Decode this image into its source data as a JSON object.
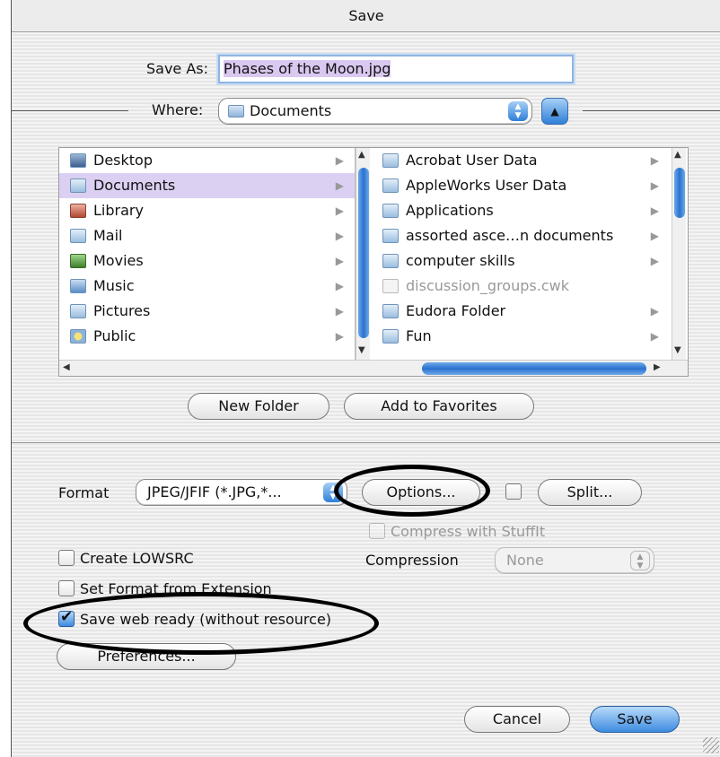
{
  "window": {
    "title": "Save"
  },
  "save_as": {
    "label": "Save As:",
    "value": "Phases of the Moon.jpg"
  },
  "where": {
    "label": "Where:",
    "value": "Documents"
  },
  "browser": {
    "column1": [
      {
        "label": "Desktop",
        "icon": "desktop-icon",
        "selected": false
      },
      {
        "label": "Documents",
        "icon": "folder-icon",
        "selected": true
      },
      {
        "label": "Library",
        "icon": "library-icon",
        "selected": false
      },
      {
        "label": "Mail",
        "icon": "folder-icon",
        "selected": false
      },
      {
        "label": "Movies",
        "icon": "movies-icon",
        "selected": false
      },
      {
        "label": "Music",
        "icon": "music-icon",
        "selected": false
      },
      {
        "label": "Pictures",
        "icon": "folder-icon",
        "selected": false
      },
      {
        "label": "Public",
        "icon": "public-icon",
        "selected": false
      }
    ],
    "column2": [
      {
        "label": "Acrobat User Data",
        "disabled": false
      },
      {
        "label": "AppleWorks User Data",
        "disabled": false
      },
      {
        "label": "Applications",
        "disabled": false
      },
      {
        "label": "assorted asce…n documents",
        "disabled": false
      },
      {
        "label": "computer skills",
        "disabled": false
      },
      {
        "label": "discussion_groups.cwk",
        "disabled": true
      },
      {
        "label": "Eudora Folder",
        "disabled": false
      },
      {
        "label": "Fun",
        "disabled": false
      }
    ]
  },
  "buttons": {
    "new_folder": "New Folder",
    "add_favorites": "Add to Favorites",
    "options": "Options...",
    "split": "Split...",
    "preferences": "Preferences...",
    "cancel": "Cancel",
    "save": "Save"
  },
  "format": {
    "label": "Format",
    "value": "JPEG/JFIF (*.JPG,*..."
  },
  "compress": {
    "label": "Compress with StuffIt",
    "checked": false
  },
  "compression": {
    "label": "Compression",
    "value": "None"
  },
  "checkboxes": {
    "create_lowsrc": {
      "label": "Create LOWSRC",
      "checked": false
    },
    "set_format": {
      "label": "Set Format from Extension",
      "checked": false
    },
    "save_web_ready": {
      "label": "Save web ready (without resource)",
      "checked": true
    }
  },
  "colors": {
    "accent": "#3f8be0",
    "selection": "#dcd0f2",
    "annotation": "#000000"
  }
}
